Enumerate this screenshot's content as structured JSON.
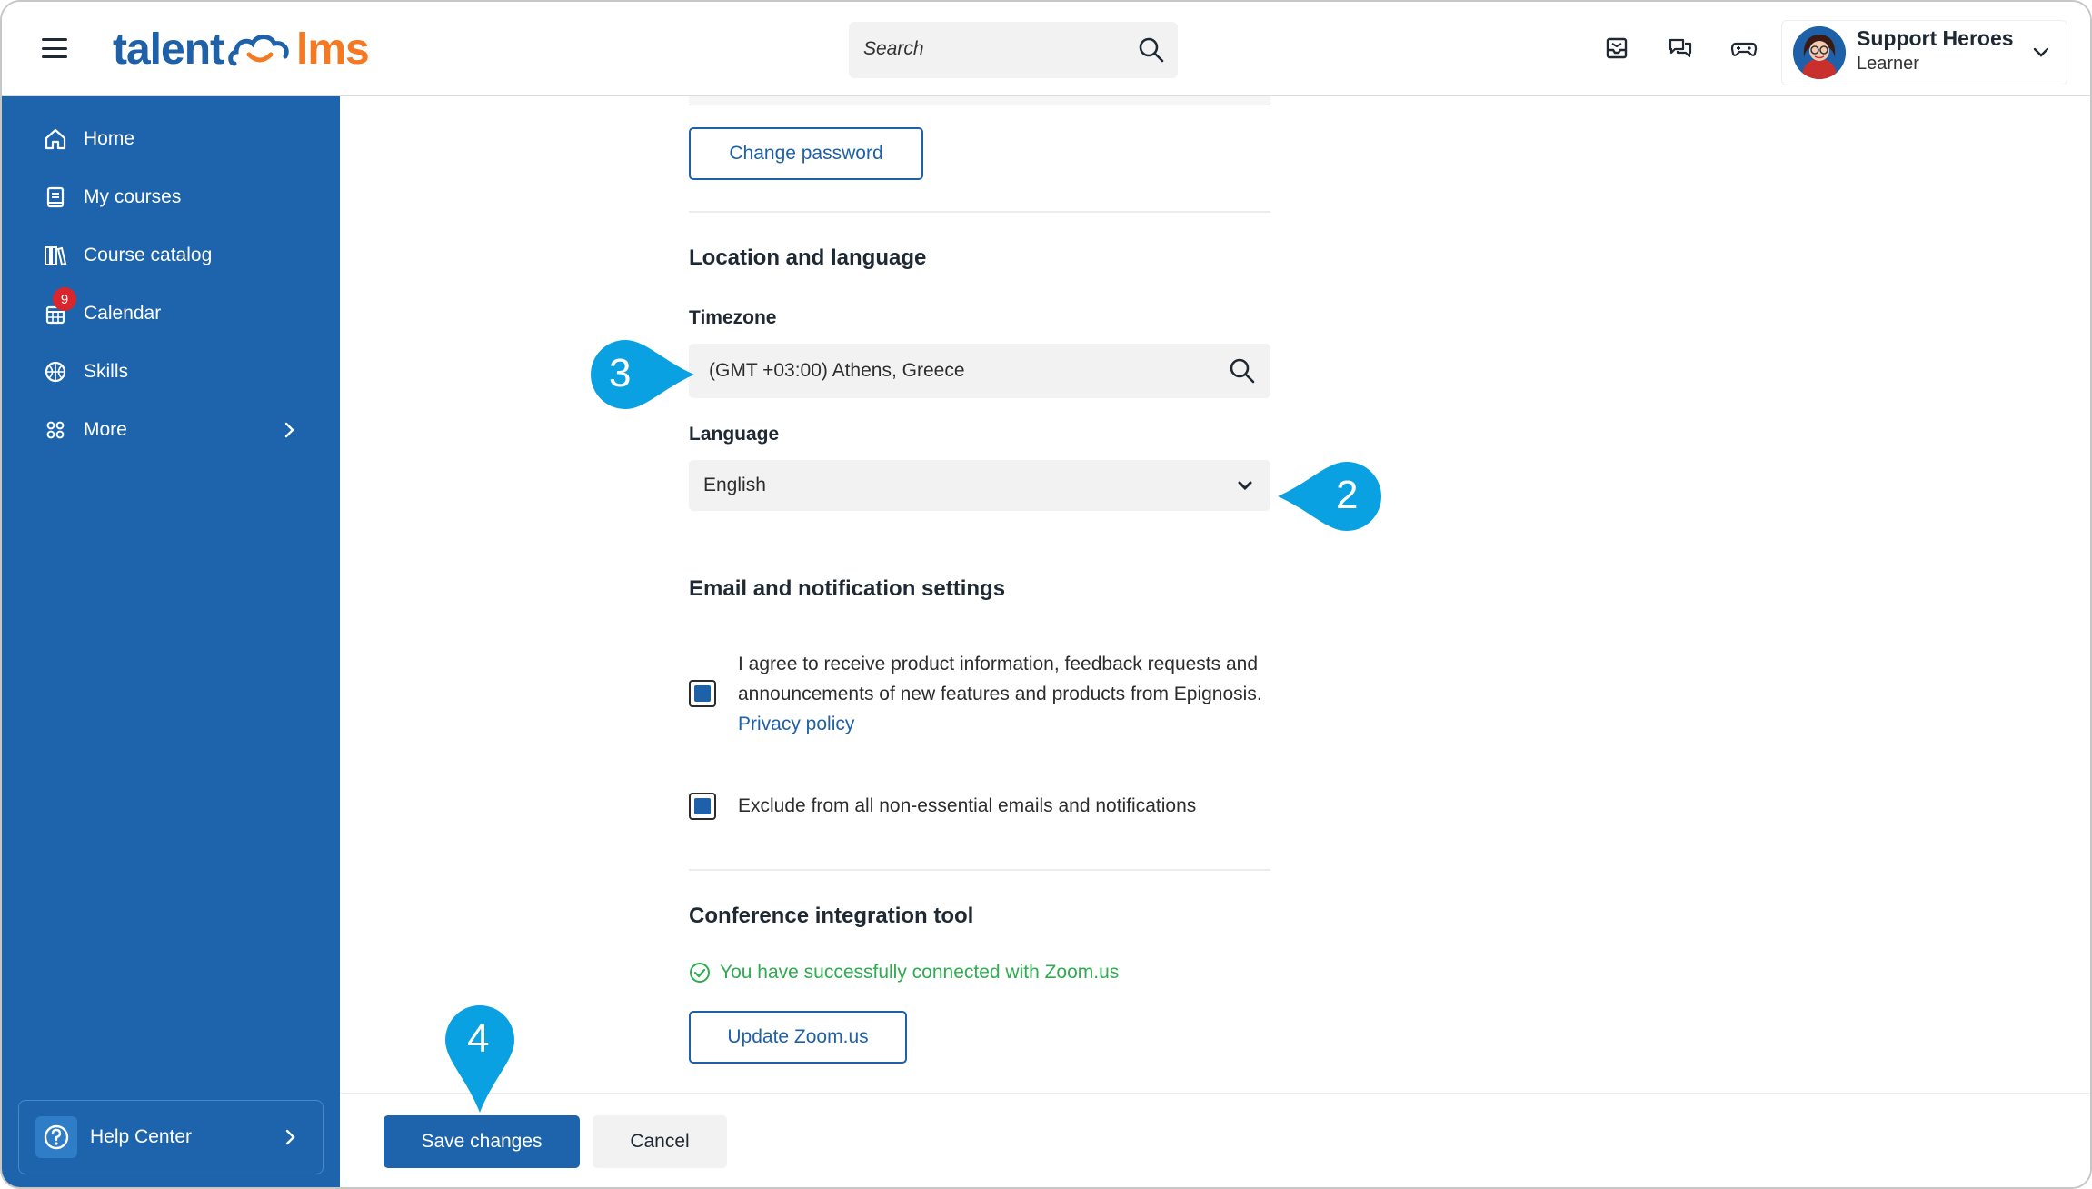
{
  "header": {
    "logo": {
      "part1": "talent",
      "part2": "lms"
    },
    "search": {
      "placeholder": "Search"
    },
    "icons": [
      "inbox-icon",
      "messages-icon",
      "gamepad-icon"
    ],
    "user": {
      "name": "Support Heroes",
      "role": "Learner"
    }
  },
  "sidebar": {
    "items": [
      {
        "label": "Home",
        "icon": "home-icon"
      },
      {
        "label": "My courses",
        "icon": "book-icon"
      },
      {
        "label": "Course catalog",
        "icon": "library-icon"
      },
      {
        "label": "Calendar",
        "icon": "calendar-icon",
        "badge": "9"
      },
      {
        "label": "Skills",
        "icon": "skills-icon"
      },
      {
        "label": "More",
        "icon": "grid-icon"
      }
    ],
    "help": {
      "label": "Help Center"
    }
  },
  "profile": {
    "change_password": "Change password",
    "location_title": "Location and language",
    "timezone_label": "Timezone",
    "timezone_value": "(GMT +03:00) Athens, Greece",
    "language_label": "Language",
    "language_value": "English",
    "email_title": "Email and notification settings",
    "consent_text": "I agree to receive product information, feedback requests and announcements of new features and products from Epignosis.",
    "privacy_link": "Privacy policy",
    "consent_checked": true,
    "exclude_text": "Exclude from all non-essential emails and notifications",
    "exclude_checked": true,
    "conference_title": "Conference integration tool",
    "zoom_status": "You have successfully connected with Zoom.us",
    "update_zoom": "Update Zoom.us"
  },
  "footer": {
    "save": "Save changes",
    "cancel": "Cancel"
  },
  "callouts": [
    {
      "number": "3",
      "color": "#0aa1e2"
    },
    {
      "number": "2",
      "color": "#0aa1e2"
    },
    {
      "number": "4",
      "color": "#0aa1e2"
    }
  ],
  "colors": {
    "primary": "#1e64ad",
    "accent": "#f47920",
    "success": "#2eac4f",
    "callout": "#0aa1e2"
  }
}
